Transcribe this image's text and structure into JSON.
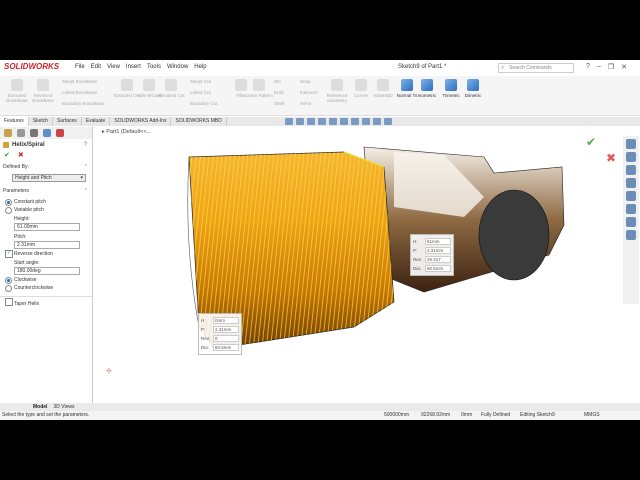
{
  "app": {
    "logo": "SOLIDWORKS",
    "doc_title": "Sketch9 of Part1 *",
    "search_placeholder": "Search Commands"
  },
  "menus": [
    "File",
    "Edit",
    "View",
    "Insert",
    "Tools",
    "Window",
    "Help"
  ],
  "ribbon": {
    "buttons": [
      {
        "label": "Extruded Boss/Base"
      },
      {
        "label": "Revolved Boss/Base"
      },
      {
        "label": "Extruded Cut"
      },
      {
        "label": "Hole Wizard"
      },
      {
        "label": "Revolved Cut"
      },
      {
        "label": "Fillet"
      },
      {
        "label": "Linear Pattern"
      },
      {
        "label": "Rib"
      },
      {
        "label": "Draft"
      },
      {
        "label": "Shell"
      },
      {
        "label": "Wrap"
      },
      {
        "label": "Intersect"
      },
      {
        "label": "Mirror"
      },
      {
        "label": "Reference Geometry"
      },
      {
        "label": "Curves"
      },
      {
        "label": "Instant3D"
      },
      {
        "label": "Normal To"
      },
      {
        "label": "Isometric"
      },
      {
        "label": "Trimetric"
      },
      {
        "label": "Dimetric"
      }
    ],
    "small": [
      "Swept Boss/Base",
      "Lofted Boss/Base",
      "Boundary Boss/Base",
      "Swept Cut",
      "Lofted Cut",
      "Boundary Cut"
    ]
  },
  "tabs": [
    "Features",
    "Sketch",
    "Surfaces",
    "Evaluate",
    "SOLIDWORKS Add-Ins",
    "SOLIDWORKS MBD"
  ],
  "tree": {
    "part": "Part1 (Default<<..."
  },
  "panel": {
    "title": "Helix/Spiral",
    "help": "?",
    "ok": "✔",
    "cancel": "✖",
    "defined_by_label": "Defined By:",
    "defined_by_value": "Height and Pitch",
    "parameters_label": "Parameters",
    "constant_pitch": "Constant pitch",
    "variable_pitch": "Variable pitch",
    "height_label": "Height:",
    "height_value": "61.00mm",
    "pitch_label": "Pitch:",
    "pitch_value": "2.31mm",
    "reverse_direction": "Reverse direction",
    "start_angle_label": "Start angle:",
    "start_angle_value": "180.00deg",
    "clockwise": "Clockwise",
    "counterclockwise": "Counterclockwise",
    "taper_helix": "Taper Helix"
  },
  "tooltip_right": {
    "H": "61mm",
    "P": "2.31mm",
    "Rev": "26.417",
    "Dia": "60.5mm"
  },
  "tooltip_left": {
    "H": "0mm",
    "P": "2.31mm",
    "Rev": "0",
    "Dia": "60.5mm"
  },
  "bottom_tabs": [
    "Model",
    "3D Views"
  ],
  "status": {
    "hint": "Select the type and set the parameters.",
    "x": "500000mm",
    "y": "92268.92mm",
    "z": "0mm",
    "state": "Fully Defined",
    "editing": "Editing Sketch9",
    "units": "MMGS"
  }
}
